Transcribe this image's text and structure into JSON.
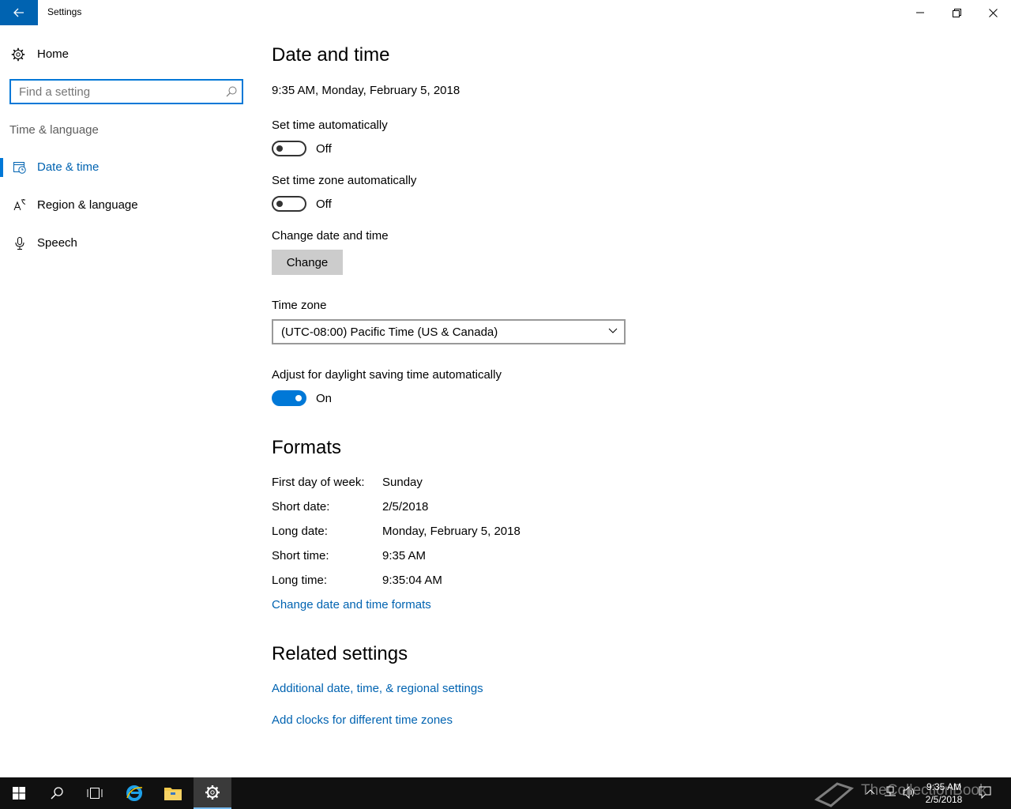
{
  "window": {
    "title": "Settings"
  },
  "sidebar": {
    "home_label": "Home",
    "search_placeholder": "Find a setting",
    "section_label": "Time & language",
    "items": [
      {
        "label": "Date & time",
        "icon": "date-time-icon",
        "active": true
      },
      {
        "label": "Region & language",
        "icon": "region-language-icon",
        "active": false
      },
      {
        "label": "Speech",
        "icon": "microphone-icon",
        "active": false
      }
    ]
  },
  "main": {
    "title": "Date and time",
    "current_datetime": "9:35 AM, Monday, February 5, 2018",
    "set_time_auto": {
      "label": "Set time automatically",
      "state": "Off",
      "on": false
    },
    "set_timezone_auto": {
      "label": "Set time zone automatically",
      "state": "Off",
      "on": false
    },
    "change_datetime": {
      "label": "Change date and time",
      "button": "Change"
    },
    "time_zone": {
      "label": "Time zone",
      "value": "(UTC-08:00) Pacific Time (US & Canada)"
    },
    "daylight_saving": {
      "label": "Adjust for daylight saving time automatically",
      "state": "On",
      "on": true
    },
    "formats": {
      "title": "Formats",
      "rows": [
        {
          "key": "First day of week:",
          "value": "Sunday"
        },
        {
          "key": "Short date:",
          "value": "2/5/2018"
        },
        {
          "key": "Long date:",
          "value": "Monday, February 5, 2018"
        },
        {
          "key": "Short time:",
          "value": "9:35 AM"
        },
        {
          "key": "Long time:",
          "value": "9:35:04 AM"
        }
      ],
      "link": "Change date and time formats"
    },
    "related": {
      "title": "Related settings",
      "links": [
        "Additional date, time, & regional settings",
        "Add clocks for different time zones"
      ]
    }
  },
  "taskbar": {
    "clock_time": "9:35 AM",
    "clock_date": "2/5/2018",
    "watermark": "TheCollectionBook"
  },
  "colors": {
    "accent": "#0078d7",
    "link": "#0063b1",
    "taskbar": "#101010"
  }
}
